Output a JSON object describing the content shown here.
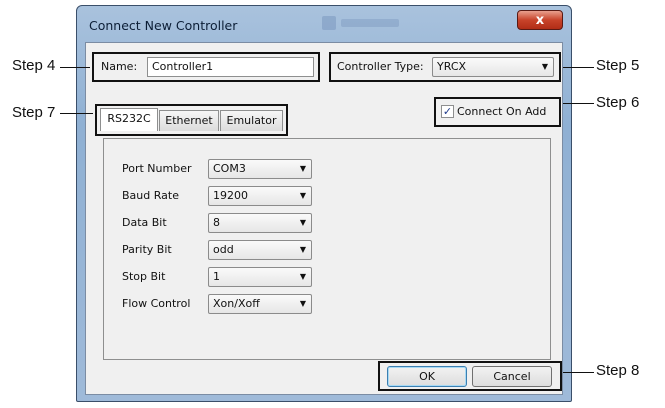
{
  "dialog": {
    "title": "Connect New Controller",
    "close_glyph": "x",
    "name_label": "Name:",
    "name_value": "Controller1",
    "controller_type_label": "Controller Type:",
    "controller_type_value": "YRCX",
    "connect_on_add_label": "Connect On Add",
    "connect_on_add_checked": true,
    "tabs": [
      {
        "label": "RS232C",
        "active": true
      },
      {
        "label": "Ethernet",
        "active": false
      },
      {
        "label": "Emulator",
        "active": false
      }
    ],
    "fields": [
      {
        "label": "Port Number",
        "value": "COM3"
      },
      {
        "label": "Baud Rate",
        "value": "19200"
      },
      {
        "label": "Data Bit",
        "value": "8"
      },
      {
        "label": "Parity Bit",
        "value": "odd"
      },
      {
        "label": "Stop Bit",
        "value": "1"
      },
      {
        "label": "Flow Control",
        "value": "Xon/Xoff"
      }
    ],
    "ok_label": "OK",
    "cancel_label": "Cancel"
  },
  "callouts": {
    "step4": "Step 4",
    "step5": "Step 5",
    "step6": "Step 6",
    "step7": "Step 7",
    "step8": "Step 8"
  },
  "icons": {
    "checkbox": "check-icon",
    "dropdown": "chevron-down-icon",
    "close": "close-icon"
  }
}
